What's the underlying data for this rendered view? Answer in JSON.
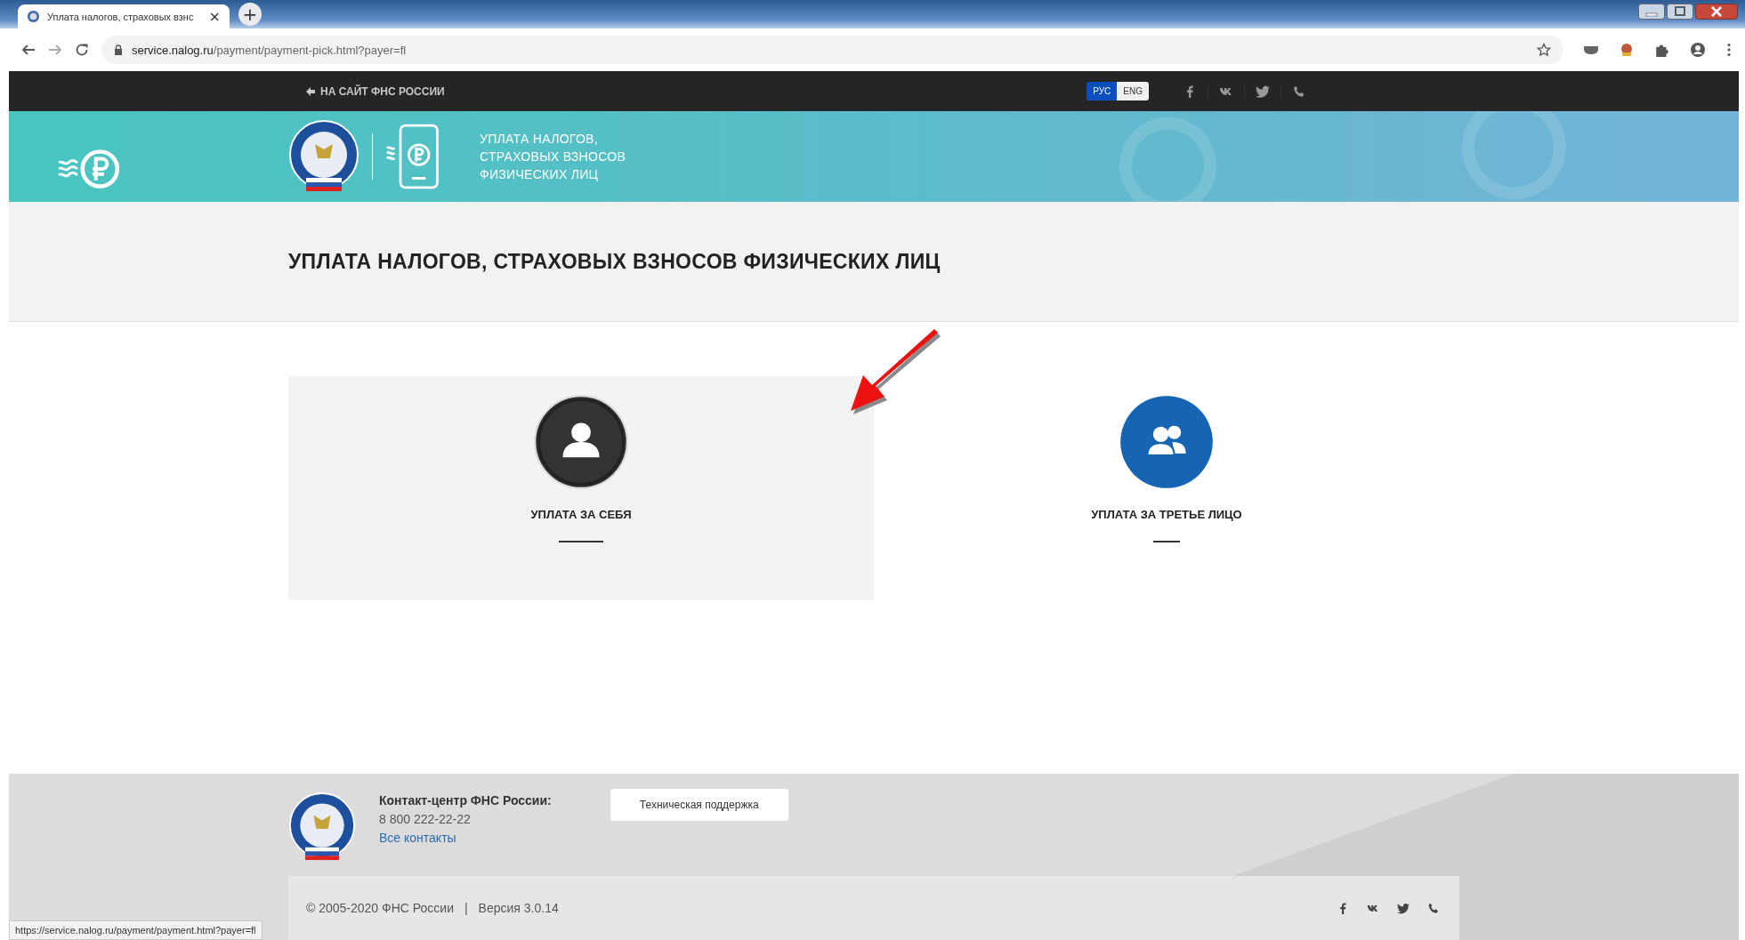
{
  "browser": {
    "tab_title": "Уплата налогов, страховых взнс",
    "tab_close": "×",
    "new_tab": "+",
    "url_host": "service.nalog.ru",
    "url_path": "/payment/payment-pick.html?payer=fl"
  },
  "topbar": {
    "back_link": "НА САЙТ ФНС РОССИИ",
    "languages": [
      {
        "label": "РУС",
        "selected": true
      },
      {
        "label": "ENG",
        "selected": false
      }
    ]
  },
  "banner": {
    "title_lines": [
      "УПЛАТА НАЛОГОВ,",
      "СТРАХОВЫХ ВЗНОСОВ",
      "ФИЗИЧЕСКИХ ЛИЦ"
    ]
  },
  "page_title": "УПЛАТА НАЛОГОВ, СТРАХОВЫХ ВЗНОСОВ ФИЗИЧЕСКИХ ЛИЦ",
  "options": [
    {
      "label": "УПЛАТА ЗА СЕБЯ",
      "kind": "self",
      "selected": true
    },
    {
      "label": "УПЛАТА ЗА ТРЕТЬЕ ЛИЦО",
      "kind": "third",
      "selected": false
    }
  ],
  "footer": {
    "contact_title": "Контакт-центр ФНС России:",
    "phone": "8 800 222-22-22",
    "contacts_link": "Все контакты",
    "support_button": "Техническая поддержка",
    "copyright": "© 2005-2020 ФНС России",
    "separator": "|",
    "version": "Версия 3.0.14"
  },
  "status_url": "https://service.nalog.ru/payment/payment.html?payer=fl"
}
